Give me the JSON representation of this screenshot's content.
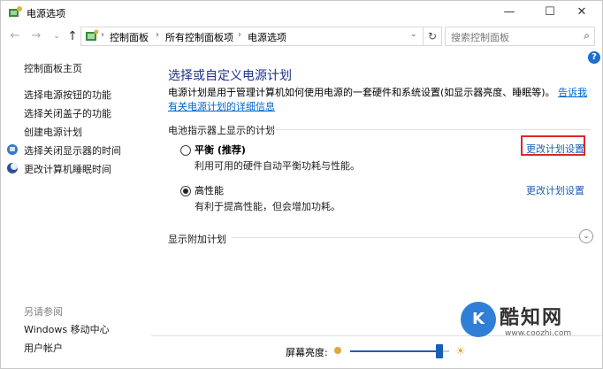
{
  "window": {
    "title": "电源选项",
    "min": "—",
    "max": "☐",
    "close": "✕"
  },
  "nav": {
    "back": "←",
    "forward": "→",
    "recent": "⌄",
    "up": "↑",
    "breadcrumbs": [
      "控制面板",
      "所有控制面板项",
      "电源选项"
    ],
    "separator": "›",
    "dropdown": "⌄",
    "refresh": "↻",
    "search_placeholder": "搜索控制面板",
    "search_icon": "⌕"
  },
  "sidebar": {
    "items": [
      {
        "label": "控制面板主页",
        "icon": ""
      },
      {
        "label": "选择电源按钮的功能",
        "icon": ""
      },
      {
        "label": "选择关闭盖子的功能",
        "icon": ""
      },
      {
        "label": "创建电源计划",
        "icon": ""
      },
      {
        "label": "选择关闭显示器的时间",
        "icon": "monitor-icon"
      },
      {
        "label": "更改计算机睡眠时间",
        "icon": "moon-icon"
      }
    ],
    "see_also_title": "另请参阅",
    "see_also": [
      "Windows 移动中心",
      "用户帐户"
    ]
  },
  "main": {
    "heading": "选择或自定义电源计划",
    "description": "电源计划是用于管理计算机如何使用电源的一套硬件和系统设置(如显示器亮度、睡眠等)。",
    "description_link": "告诉我有关电源计划的详细信息",
    "section_title": "电池指示器上显示的计划",
    "plans": [
      {
        "name": "平衡 (推荐)",
        "desc": "利用可用的硬件自动平衡功耗与性能。",
        "selected": false,
        "change_label": "更改计划设置"
      },
      {
        "name": "高性能",
        "desc": "有利于提高性能，但会增加功耗。",
        "selected": true,
        "change_label": "更改计划设置"
      }
    ],
    "more_plans": "显示附加计划",
    "expand_icon": "⌄",
    "help": "?"
  },
  "brightness": {
    "label": "屏幕亮度:",
    "level": 0.9,
    "sun_large": "☀"
  },
  "watermark": {
    "logo": "K",
    "title": "酷知网",
    "url": "www.coozhi.com"
  },
  "colors": {
    "accent": "#1a5fb4",
    "heading": "#1e3287",
    "highlight": "#d9292c"
  }
}
